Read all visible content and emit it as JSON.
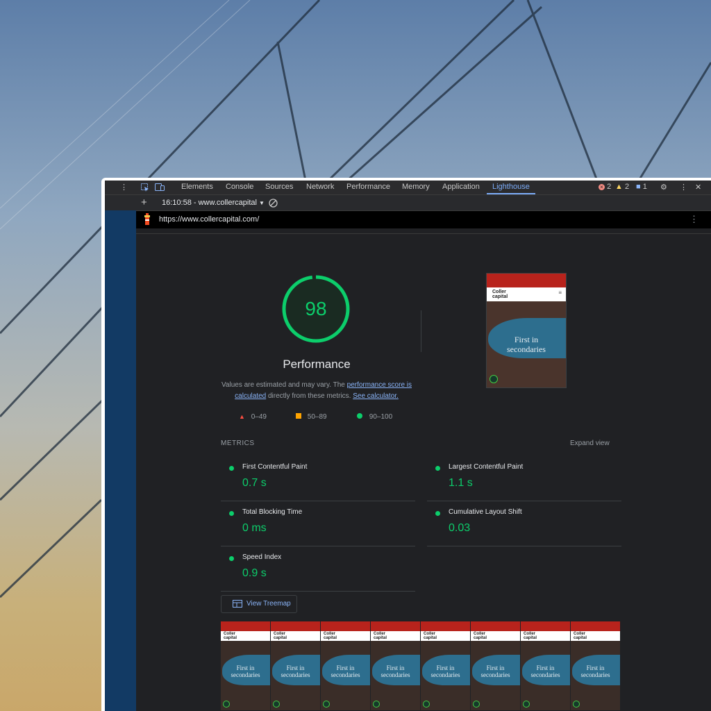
{
  "colors": {
    "accent": "#7cacf8",
    "pass": "#0cce6b",
    "average": "#ffa400",
    "fail": "#ff4e42",
    "panel_bg": "#202124",
    "sidebar": "#123a64"
  },
  "tabs": [
    {
      "label": "Elements"
    },
    {
      "label": "Console"
    },
    {
      "label": "Sources"
    },
    {
      "label": "Network"
    },
    {
      "label": "Performance"
    },
    {
      "label": "Memory"
    },
    {
      "label": "Application"
    },
    {
      "label": "Lighthouse"
    }
  ],
  "active_tab": "Lighthouse",
  "status": {
    "errors": "2",
    "warnings": "2",
    "messages": "1"
  },
  "toolbar": {
    "report_selector": "16:10:58 - www.collercapital"
  },
  "url_bar": {
    "url": "https://www.collercapital.com/"
  },
  "report": {
    "score": "98",
    "category": "Performance",
    "desc_prefix": "Values are estimated and may vary. The ",
    "desc_link1": "performance score is calculated",
    "desc_mid": " directly from these metrics. ",
    "desc_link2": "See calculator.",
    "legend": [
      {
        "range": "0–49"
      },
      {
        "range": "50–89"
      },
      {
        "range": "90–100"
      }
    ],
    "metrics_header": "METRICS",
    "expand_label": "Expand view",
    "metrics": [
      {
        "title": "First Contentful Paint",
        "value": "0.7 s"
      },
      {
        "title": "Largest Contentful Paint",
        "value": "1.1 s"
      },
      {
        "title": "Total Blocking Time",
        "value": "0 ms"
      },
      {
        "title": "Cumulative Layout Shift",
        "value": "0.03"
      },
      {
        "title": "Speed Index",
        "value": "0.9 s"
      }
    ],
    "treemap_label": "View Treemap"
  },
  "thumbnail": {
    "logo_line1": "Coller",
    "logo_line2": "capital",
    "hero_text_line1": "First in",
    "hero_text_line2": "secondaries"
  },
  "filmstrip_frames": [
    {
      "hero1": "First in",
      "hero2": "secondaries"
    },
    {
      "hero1": "First in",
      "hero2": "secondaries"
    },
    {
      "hero1": "First in",
      "hero2": "secondaries"
    },
    {
      "hero1": "First in",
      "hero2": "secondaries"
    },
    {
      "hero1": "First in",
      "hero2": "secondaries"
    },
    {
      "hero1": "First in",
      "hero2": "secondaries"
    },
    {
      "hero1": "First in",
      "hero2": "secondaries"
    },
    {
      "hero1": "First in",
      "hero2": "secondaries"
    }
  ]
}
